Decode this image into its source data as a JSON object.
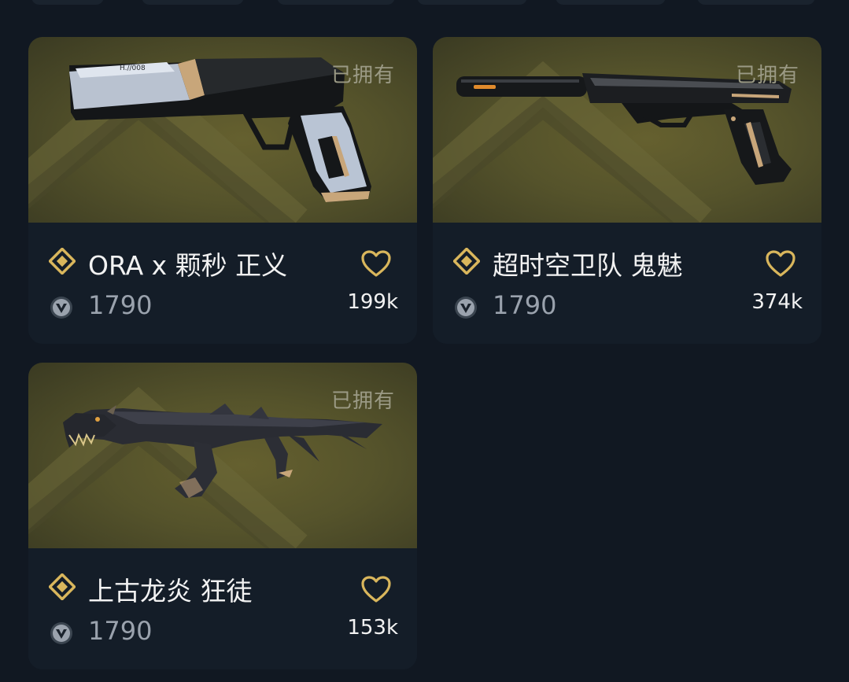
{
  "colors": {
    "background": "#111822",
    "card": "#141d28",
    "image_bg": "#55532b",
    "gold": "#d9b65c",
    "owned_text": "#9b9a85",
    "price_text": "#9aa2ad",
    "name_text": "#f2f2f2"
  },
  "cards": [
    {
      "owned_label": "已拥有",
      "name": "ORA x 颗秒 正义",
      "price": "1790",
      "likes": "199k",
      "weapon_icon": "pistol-sheriff-icon",
      "tier_icon": "premium-tier-diamond-icon",
      "currency_icon": "valorant-points-icon",
      "favorite_icon": "heart-outline-icon"
    },
    {
      "owned_label": "已拥有",
      "name": "超时空卫队 鬼魅",
      "price": "1790",
      "likes": "374k",
      "weapon_icon": "pistol-ghost-icon",
      "tier_icon": "premium-tier-diamond-icon",
      "currency_icon": "valorant-points-icon",
      "favorite_icon": "heart-outline-icon"
    },
    {
      "owned_label": "已拥有",
      "name": "上古龙炎 狂徒",
      "price": "1790",
      "likes": "153k",
      "weapon_icon": "rifle-dragon-vandal-icon",
      "tier_icon": "premium-tier-diamond-icon",
      "currency_icon": "valorant-points-icon",
      "favorite_icon": "heart-outline-icon"
    }
  ]
}
